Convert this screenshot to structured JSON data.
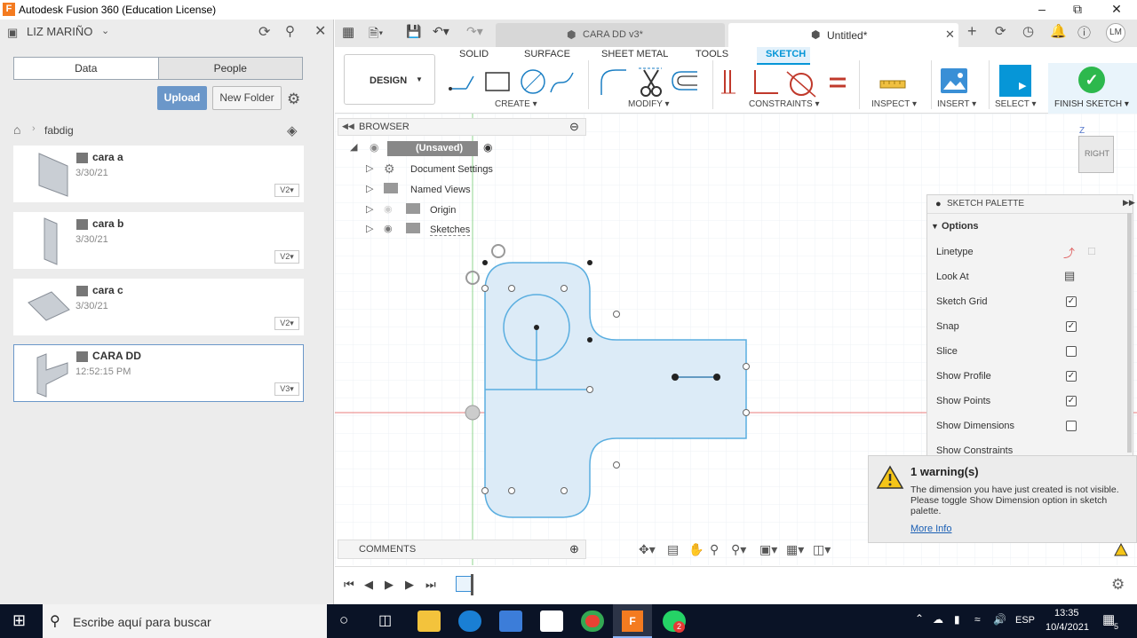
{
  "window": {
    "title": "Autodesk Fusion 360 (Education License)"
  },
  "left_panel": {
    "user": "LIZ MARIÑO",
    "tabs": [
      "Data",
      "People"
    ],
    "upload": "Upload",
    "new_folder": "New Folder",
    "breadcrumb": "fabdig",
    "files": [
      {
        "name": "cara a",
        "date": "3/30/21",
        "version": "V2"
      },
      {
        "name": "cara b",
        "date": "3/30/21",
        "version": "V2"
      },
      {
        "name": "cara c",
        "date": "3/30/21",
        "version": "V2"
      },
      {
        "name": "CARA DD",
        "date": "12:52:15 PM",
        "version": "V3"
      }
    ]
  },
  "doc_tabs": [
    {
      "label": "CARA DD v3*"
    },
    {
      "label": "Untitled*"
    }
  ],
  "user_initials": "LM",
  "toolbar": {
    "workspace": "DESIGN",
    "tabs": [
      "SOLID",
      "SURFACE",
      "SHEET METAL",
      "TOOLS",
      "SKETCH"
    ],
    "active_tab": "SKETCH",
    "groups": [
      "CREATE",
      "MODIFY",
      "CONSTRAINTS",
      "INSPECT",
      "INSERT",
      "SELECT",
      "FINISH SKETCH"
    ]
  },
  "browser": {
    "title": "BROWSER",
    "root": "(Unsaved)",
    "items": [
      "Document Settings",
      "Named Views",
      "Origin",
      "Sketches"
    ]
  },
  "comments": {
    "title": "COMMENTS"
  },
  "view_cube": {
    "face": "RIGHT",
    "axis": "Z"
  },
  "sketch_palette": {
    "title": "SKETCH PALETTE",
    "section": "Options",
    "rows": [
      {
        "label": "Linetype",
        "type": "icon"
      },
      {
        "label": "Look At",
        "type": "icon"
      },
      {
        "label": "Sketch Grid",
        "checked": true
      },
      {
        "label": "Snap",
        "checked": true
      },
      {
        "label": "Slice",
        "checked": false
      },
      {
        "label": "Show Profile",
        "checked": true
      },
      {
        "label": "Show Points",
        "checked": true
      },
      {
        "label": "Show Dimensions",
        "checked": false
      },
      {
        "label": "Show Constraints",
        "checked": false
      }
    ]
  },
  "warning": {
    "title": "1 warning(s)",
    "message": "The dimension you have just created is not visible. Please toggle Show Dimension option in sketch palette.",
    "link": "More Info"
  },
  "taskbar": {
    "search_placeholder": "Escribe aquí para buscar",
    "language": "ESP",
    "time": "13:35",
    "date": "10/4/2021",
    "notification_count": "5",
    "whatsapp_badge": "2"
  },
  "colors": {
    "accent": "#0696d7",
    "profile_fill": "#dcebf7",
    "sketch_line": "#5aaee0",
    "finish_green": "#2db84d"
  }
}
